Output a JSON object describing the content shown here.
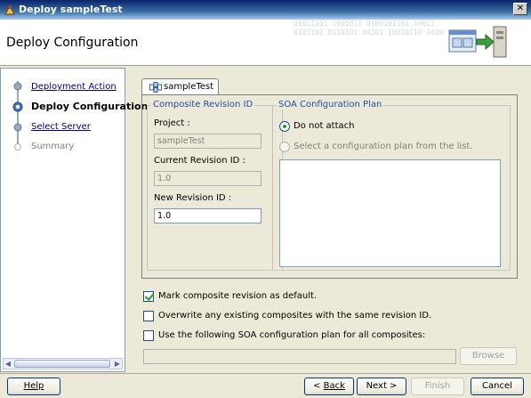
{
  "window": {
    "title": "Deploy sampleTest",
    "close_glyph": "✕"
  },
  "header": {
    "title": "Deploy Configuration",
    "binary_text": "01011101 1001011 0100101101 10011 0101101 0110101 00101 10010110 1010"
  },
  "nav": {
    "items": [
      {
        "label": "Deployment Action",
        "state": "link"
      },
      {
        "label": "Deploy Configuration",
        "state": "current"
      },
      {
        "label": "Select Server",
        "state": "link"
      },
      {
        "label": "Summary",
        "state": "disabled"
      }
    ],
    "scroll_left": "◀",
    "scroll_right": "▶"
  },
  "tab": {
    "label": "sampleTest",
    "icon": "composite-icon"
  },
  "composite_revision": {
    "title": "Composite Revision ID",
    "project_label": "Project :",
    "project_value": "sampleTest",
    "current_label": "Current Revision ID :",
    "current_value": "1.0",
    "new_label": "New Revision ID :",
    "new_value": "1.0"
  },
  "soa_plan": {
    "title": "SOA Configuration Plan",
    "option_none": "Do not attach",
    "option_select": "Select a configuration plan from the list."
  },
  "options": {
    "mark_default": "Mark composite revision as default.",
    "overwrite": "Overwrite any existing composites with the same revision ID.",
    "use_plan": "Use the following SOA configuration plan for all composites:"
  },
  "browse_label": "Browse",
  "footer": {
    "help": "Help",
    "back": "Back",
    "next": "Next >",
    "finish": "Finish",
    "cancel": "Cancel",
    "back_prefix": "< "
  },
  "colors": {
    "accent": "#1e50a2",
    "link": "#000080",
    "title_bar": "#0a246a"
  }
}
